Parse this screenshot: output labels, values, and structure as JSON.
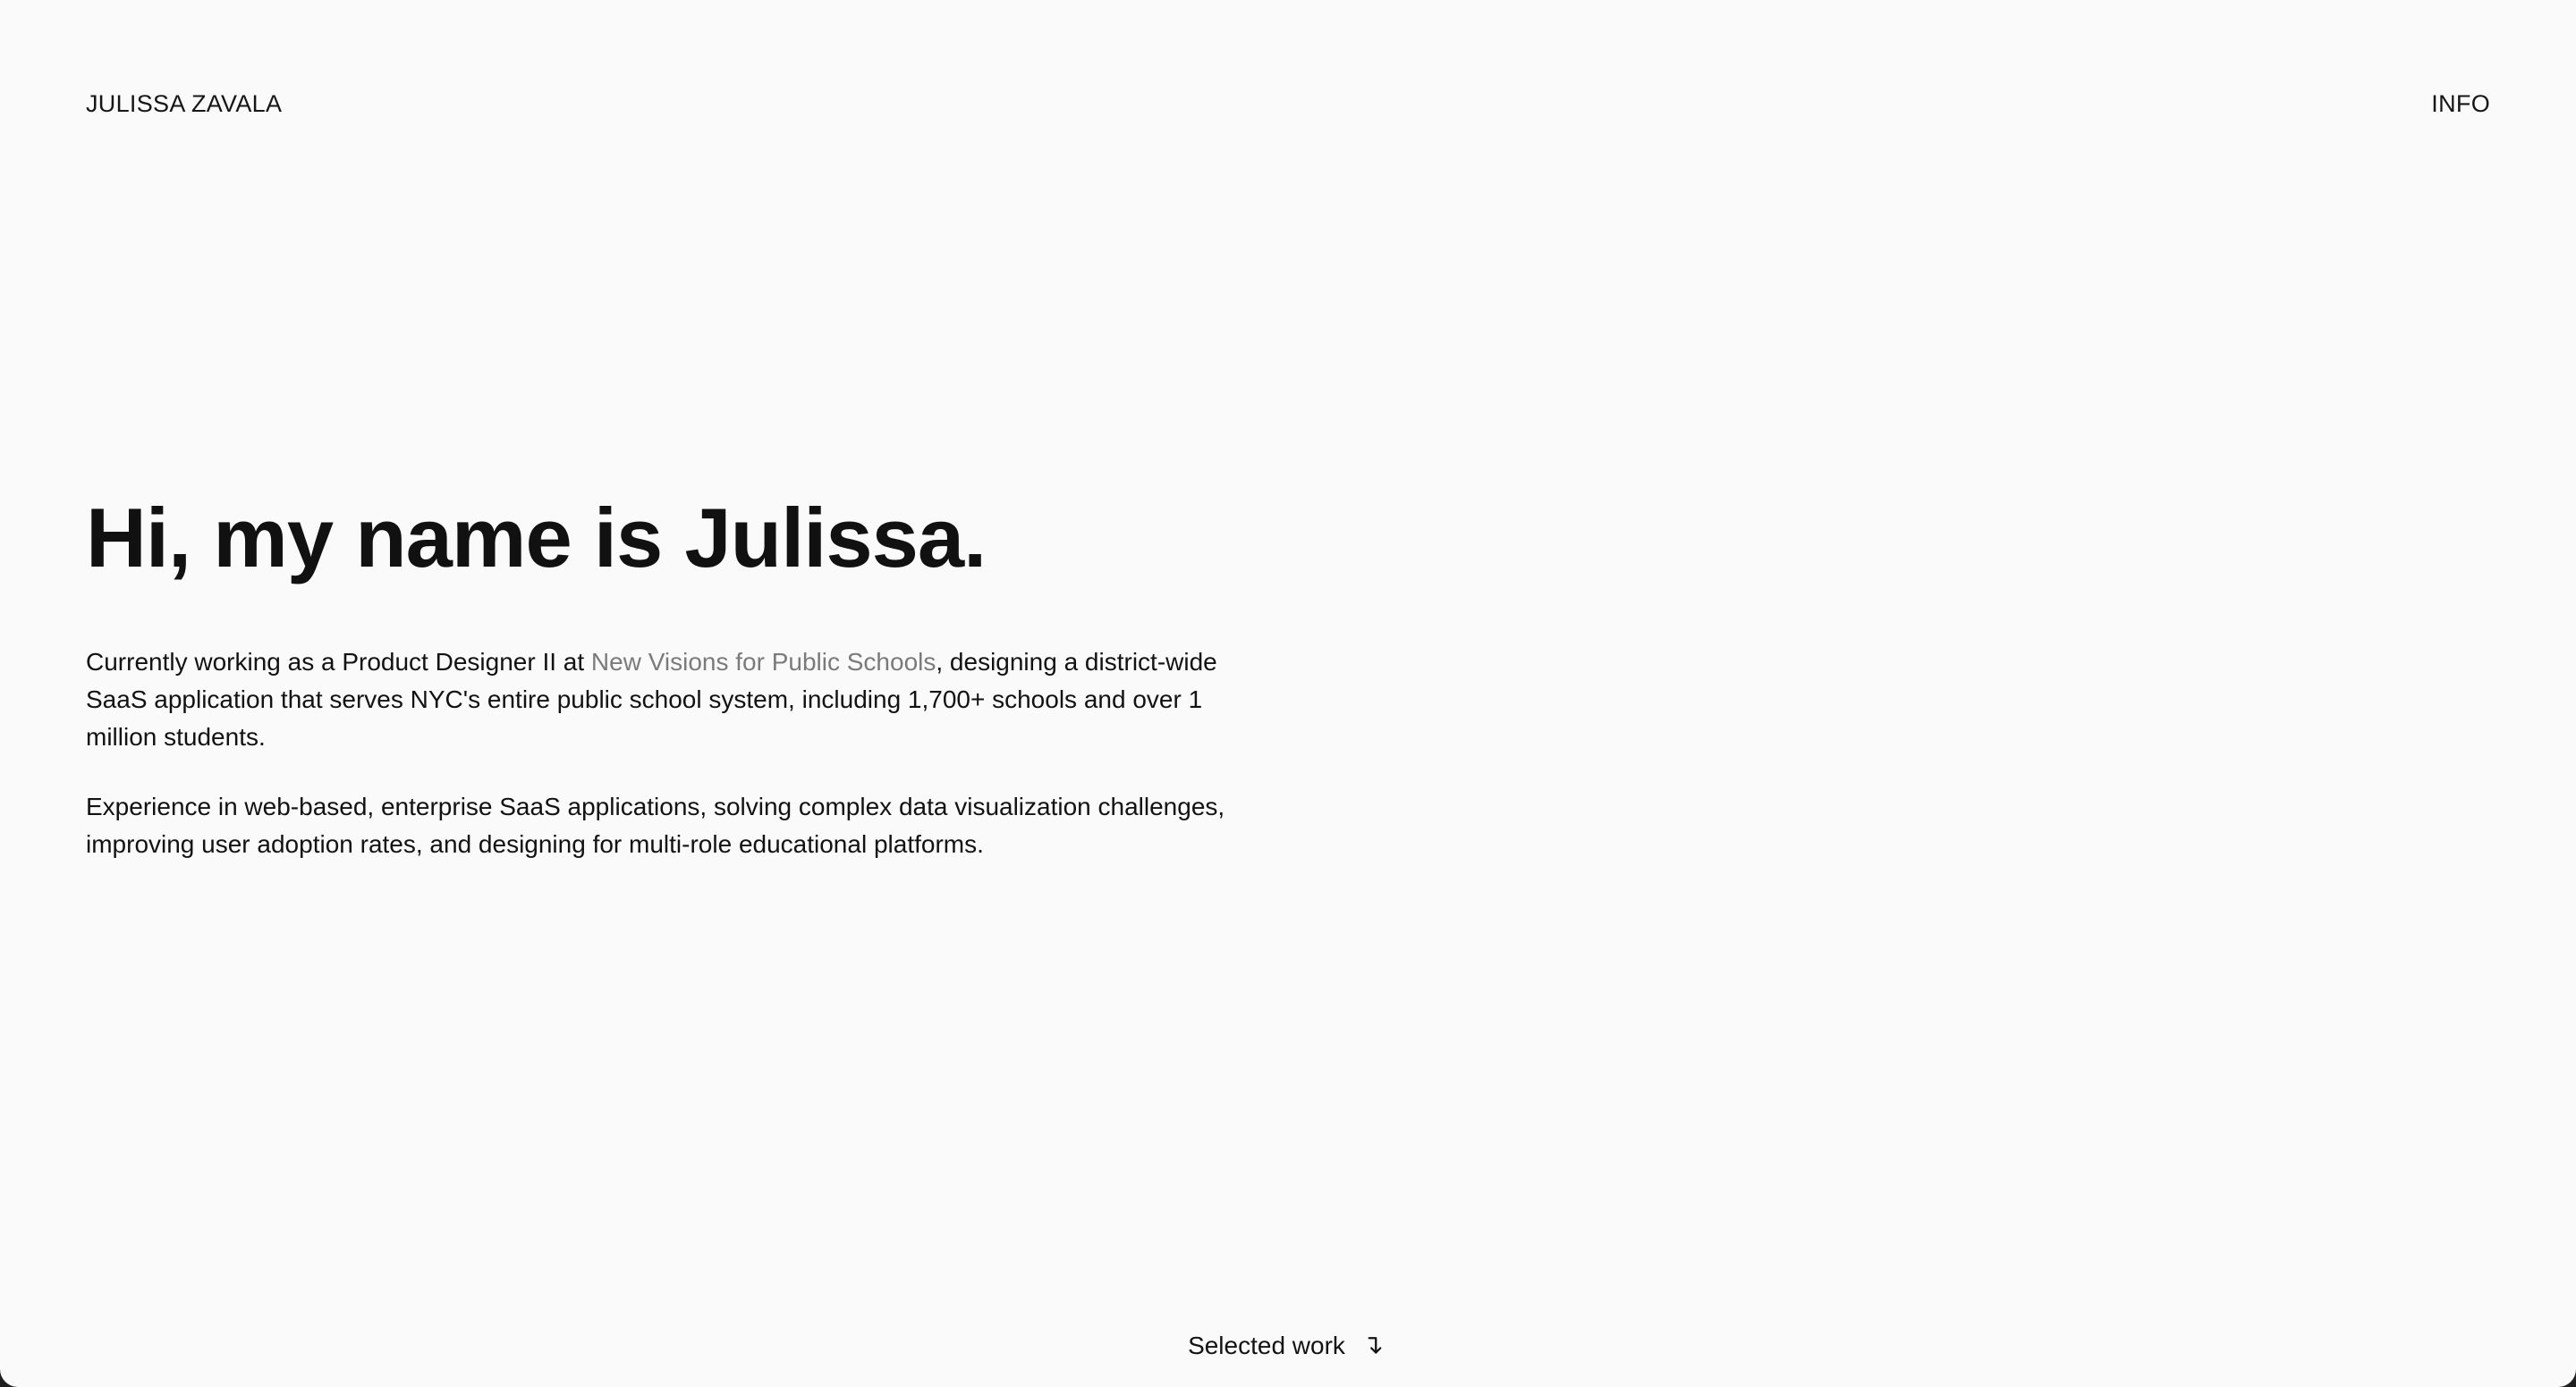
{
  "header": {
    "brand": "JULISSA ZAVALA",
    "nav": "INFO"
  },
  "hero": {
    "title": "Hi, my name is Julissa.",
    "paragraph1": {
      "before": "Currently working as a Product Designer II at ",
      "link": "New Visions for Public Schools",
      "after": ", designing a district-wide SaaS application that serves NYC's entire public school system, including 1,700+ schools and over 1 million students."
    },
    "paragraph2": "Experience in web-based, enterprise SaaS applications, solving complex data visualization challenges, improving user adoption rates, and designing for multi-role educational platforms."
  },
  "footer": {
    "cta": "Selected work",
    "cta_icon": "arrow-down-right-icon"
  },
  "colors": {
    "background": "#fafafa",
    "text": "#111111",
    "link": "#7b7b7b"
  }
}
